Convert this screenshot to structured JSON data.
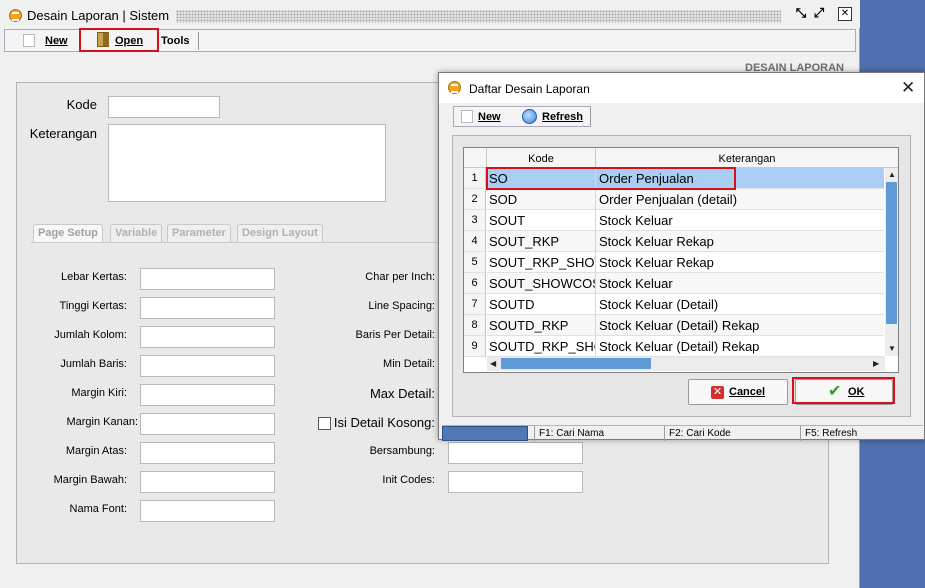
{
  "main_window": {
    "title": "Desain Laporan | Sistem",
    "controls": [
      "restore-icon",
      "maximize-icon",
      "close-icon"
    ],
    "toolbar": {
      "new_label": "New",
      "open_label": "Open",
      "tools_label": "Tools"
    },
    "header_label": "DESAIN LAPORAN",
    "form": {
      "kode_label": "Kode",
      "keterangan_label": "Keterangan",
      "tabs": [
        "Page Setup",
        "Variable",
        "Parameter",
        "Design Layout"
      ],
      "left_fields": [
        "Lebar Kertas:",
        "Tinggi Kertas:",
        "Jumlah Kolom:",
        "Jumlah Baris:",
        "Margin Kiri:",
        "Margin Kanan:",
        "Margin Atas:",
        "Margin Bawah:",
        "Nama Font:"
      ],
      "right_fields": {
        "char_per_inch": "Char per Inch:",
        "line_spacing": "Line Spacing:",
        "baris_per_detail": "Baris Per Detail:",
        "min_detail": "Min Detail:",
        "max_detail": "Max Detail:",
        "isi_detail_kosong": "Isi Detail Kosong:",
        "bersambung": "Bersambung:",
        "init_codes": "Init Codes:"
      }
    }
  },
  "dialog": {
    "title": "Daftar Desain Laporan",
    "toolbar": {
      "new_label": "New",
      "refresh_label": "Refresh"
    },
    "grid": {
      "columns": [
        "Kode",
        "Keterangan"
      ],
      "rows": [
        {
          "no": "1",
          "kode": "SO",
          "keterangan": "Order Penjualan"
        },
        {
          "no": "2",
          "kode": "SOD",
          "keterangan": "Order Penjualan (detail)"
        },
        {
          "no": "3",
          "kode": "SOUT",
          "keterangan": "Stock Keluar"
        },
        {
          "no": "4",
          "kode": "SOUT_RKP",
          "keterangan": "Stock Keluar Rekap"
        },
        {
          "no": "5",
          "kode": "SOUT_RKP_SHOW",
          "keterangan": "Stock Keluar Rekap"
        },
        {
          "no": "6",
          "kode": "SOUT_SHOWCOST",
          "keterangan": "Stock Keluar"
        },
        {
          "no": "7",
          "kode": "SOUTD",
          "keterangan": "Stock Keluar (Detail)"
        },
        {
          "no": "8",
          "kode": "SOUTD_RKP",
          "keterangan": "Stock Keluar (Detail) Rekap"
        },
        {
          "no": "9",
          "kode": "SOUTD_RKP_SHOW",
          "keterangan": "Stock Keluar (Detail) Rekap"
        }
      ],
      "selected_row": 1
    },
    "buttons": {
      "cancel_label": "Cancel",
      "ok_label": "OK"
    },
    "status": [
      "F1: Cari Nama",
      "F2: Cari Kode",
      "F5: Refresh"
    ]
  },
  "colors": {
    "highlight_box": "#d8101a",
    "selection": "#a9cdf3",
    "desktop": "#4f6fae"
  }
}
